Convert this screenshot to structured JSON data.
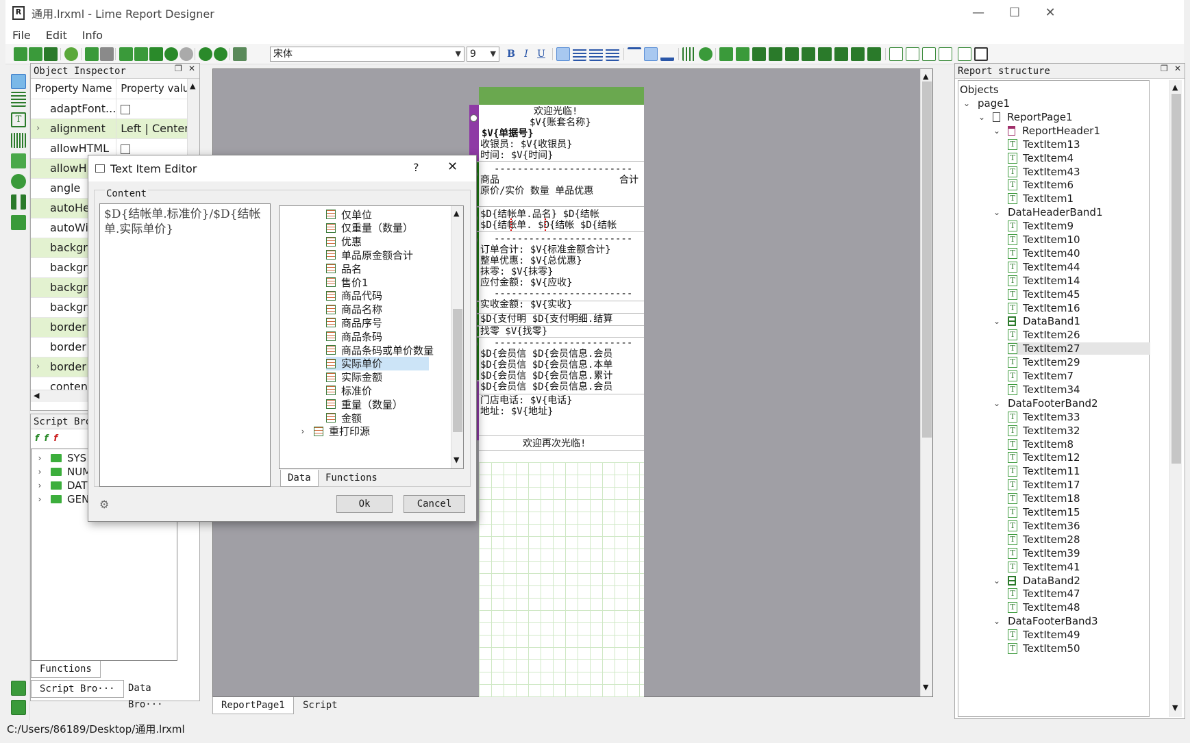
{
  "window": {
    "title": "通用.lrxml - Lime Report Designer",
    "icon_letter": "R"
  },
  "menu": [
    "File",
    "Edit",
    "Info"
  ],
  "toolbar": {
    "font": "宋体",
    "size": "9",
    "bold": "B",
    "italic": "I",
    "underline": "U"
  },
  "object_inspector": {
    "title": "Object Inspector",
    "col_name": "Property Name",
    "col_value": "Property valu",
    "rows": [
      {
        "name": "adaptFont...",
        "value": "",
        "checkbox": true,
        "alt": false
      },
      {
        "name": "alignment",
        "value": "Left | Center",
        "expandable": true,
        "alt": true
      },
      {
        "name": "allowHTML",
        "value": "",
        "checkbox": true,
        "alt": false
      },
      {
        "name": "allowH",
        "value": "",
        "alt": true
      },
      {
        "name": "angle",
        "value": "",
        "alt": false
      },
      {
        "name": "autoHe",
        "value": "",
        "alt": true
      },
      {
        "name": "autoWi",
        "value": "",
        "alt": false
      },
      {
        "name": "backgro",
        "value": "",
        "alt": true
      },
      {
        "name": "backgro",
        "value": "",
        "alt": false
      },
      {
        "name": "backgro",
        "value": "",
        "alt": true
      },
      {
        "name": "backgro",
        "value": "",
        "alt": false
      },
      {
        "name": "border",
        "value": "",
        "alt": true
      },
      {
        "name": "border",
        "value": "",
        "alt": false
      },
      {
        "name": "border",
        "value": "",
        "expandable": true,
        "alt": true
      },
      {
        "name": "conten",
        "value": "",
        "alt": false
      }
    ]
  },
  "script_browser": {
    "title": "Script Bro",
    "items": [
      "SYS",
      "NUM",
      "DAT",
      "GEN"
    ],
    "tabs": [
      "Functions"
    ],
    "bottom_tabs": [
      "Script Bro···",
      "Data Bro···"
    ]
  },
  "design_tabs": [
    "ReportPage1",
    "Script"
  ],
  "report_lines": {
    "welcome": "欢迎光临!",
    "account": "$V{账套名称}",
    "billno": "$V{单据号}",
    "cashier": "收银员: $V{收银员}",
    "time": "时间: $V{时间}",
    "dashes": "------------------------",
    "goods": "商品",
    "total": "合计",
    "hdr_cols": "原价/实价    数量    单品优惠",
    "row1": "$D{结帐单.品名}      $D{结帐",
    "row2": "$D{结帐单.   $D{结帐    $D{结帐",
    "order_total": "订单合计:   $V{标准金额合计}",
    "discount": "整单优惠:         $V{总优惠}",
    "rounding": "抹零:               $V{抹零}",
    "receivable": "应付金额:           $V{应收}",
    "received": "实收金额:           $V{实收}",
    "pay": "$D{支付明   $D{支付明细.结算",
    "change": "找零               $V{找零}",
    "m1": "$D{会员信    $D{会员信息.会员",
    "m2": "$D{会员信    $D{会员信息.本单",
    "m3": "$D{会员信    $D{会员信息.累计",
    "m4": "$D{会员信    $D{会员信息.会员",
    "phone": "门店电话:  $V{电话}",
    "address": "地址: $V{地址}",
    "farewell": "欢迎再次光临!"
  },
  "report_structure": {
    "title": "Report structure",
    "root": "Objects",
    "nodes": [
      {
        "label": "page1",
        "level": 0,
        "kind": "chev"
      },
      {
        "label": "ReportPage1",
        "level": 1,
        "kind": "page"
      },
      {
        "label": "ReportHeader1",
        "level": 2,
        "kind": "rheader"
      },
      {
        "label": "TextItem13",
        "level": 3,
        "kind": "text"
      },
      {
        "label": "TextItem4",
        "level": 3,
        "kind": "text"
      },
      {
        "label": "TextItem43",
        "level": 3,
        "kind": "text"
      },
      {
        "label": "TextItem6",
        "level": 3,
        "kind": "text"
      },
      {
        "label": "TextItem1",
        "level": 3,
        "kind": "text"
      },
      {
        "label": "DataHeaderBand1",
        "level": 2,
        "kind": "none"
      },
      {
        "label": "TextItem9",
        "level": 3,
        "kind": "text"
      },
      {
        "label": "TextItem10",
        "level": 3,
        "kind": "text"
      },
      {
        "label": "TextItem40",
        "level": 3,
        "kind": "text"
      },
      {
        "label": "TextItem44",
        "level": 3,
        "kind": "text"
      },
      {
        "label": "TextItem14",
        "level": 3,
        "kind": "text"
      },
      {
        "label": "TextItem45",
        "level": 3,
        "kind": "text"
      },
      {
        "label": "TextItem16",
        "level": 3,
        "kind": "text"
      },
      {
        "label": "DataBand1",
        "level": 2,
        "kind": "band"
      },
      {
        "label": "TextItem26",
        "level": 3,
        "kind": "text"
      },
      {
        "label": "TextItem27",
        "level": 3,
        "kind": "text",
        "selected": true
      },
      {
        "label": "TextItem29",
        "level": 3,
        "kind": "text"
      },
      {
        "label": "TextItem7",
        "level": 3,
        "kind": "text"
      },
      {
        "label": "TextItem34",
        "level": 3,
        "kind": "text"
      },
      {
        "label": "DataFooterBand2",
        "level": 2,
        "kind": "none"
      },
      {
        "label": "TextItem33",
        "level": 3,
        "kind": "text"
      },
      {
        "label": "TextItem32",
        "level": 3,
        "kind": "text"
      },
      {
        "label": "TextItem8",
        "level": 3,
        "kind": "text"
      },
      {
        "label": "TextItem12",
        "level": 3,
        "kind": "text"
      },
      {
        "label": "TextItem11",
        "level": 3,
        "kind": "text"
      },
      {
        "label": "TextItem17",
        "level": 3,
        "kind": "text"
      },
      {
        "label": "TextItem18",
        "level": 3,
        "kind": "text"
      },
      {
        "label": "TextItem15",
        "level": 3,
        "kind": "text"
      },
      {
        "label": "TextItem36",
        "level": 3,
        "kind": "text"
      },
      {
        "label": "TextItem28",
        "level": 3,
        "kind": "text"
      },
      {
        "label": "TextItem39",
        "level": 3,
        "kind": "text"
      },
      {
        "label": "TextItem41",
        "level": 3,
        "kind": "text"
      },
      {
        "label": "DataBand2",
        "level": 2,
        "kind": "band"
      },
      {
        "label": "TextItem47",
        "level": 3,
        "kind": "text"
      },
      {
        "label": "TextItem48",
        "level": 3,
        "kind": "text"
      },
      {
        "label": "DataFooterBand3",
        "level": 2,
        "kind": "none"
      },
      {
        "label": "TextItem49",
        "level": 3,
        "kind": "text"
      },
      {
        "label": "TextItem50",
        "level": 3,
        "kind": "text"
      }
    ]
  },
  "dialog": {
    "title": "Text Item Editor",
    "help": "?",
    "close": "✕",
    "content_label": "Content",
    "content_text": "$D{结帐单.标准价}/$D{结帐单.实际单价}",
    "fields": [
      "仅单位",
      "仅重量（数量）",
      "优惠",
      "单品原金额合计",
      "品名",
      "售价1",
      "商品代码",
      "商品名称",
      "商品序号",
      "商品条码",
      "商品条码或单价数量",
      "实际单价",
      "实际金额",
      "标准价",
      "重量（数量）",
      "金额"
    ],
    "selected_field": "实际单价",
    "group_node": "重打印源",
    "tabs": [
      "Data",
      "Functions"
    ],
    "ok": "Ok",
    "cancel": "Cancel"
  },
  "status": "C:/Users/86189/Desktop/通用.lrxml",
  "colors": {
    "band_green": "#1e7a12",
    "band_purple": "#8e3aa5",
    "header_green": "#6aa84f",
    "alt_row": "#e3f2d0"
  }
}
